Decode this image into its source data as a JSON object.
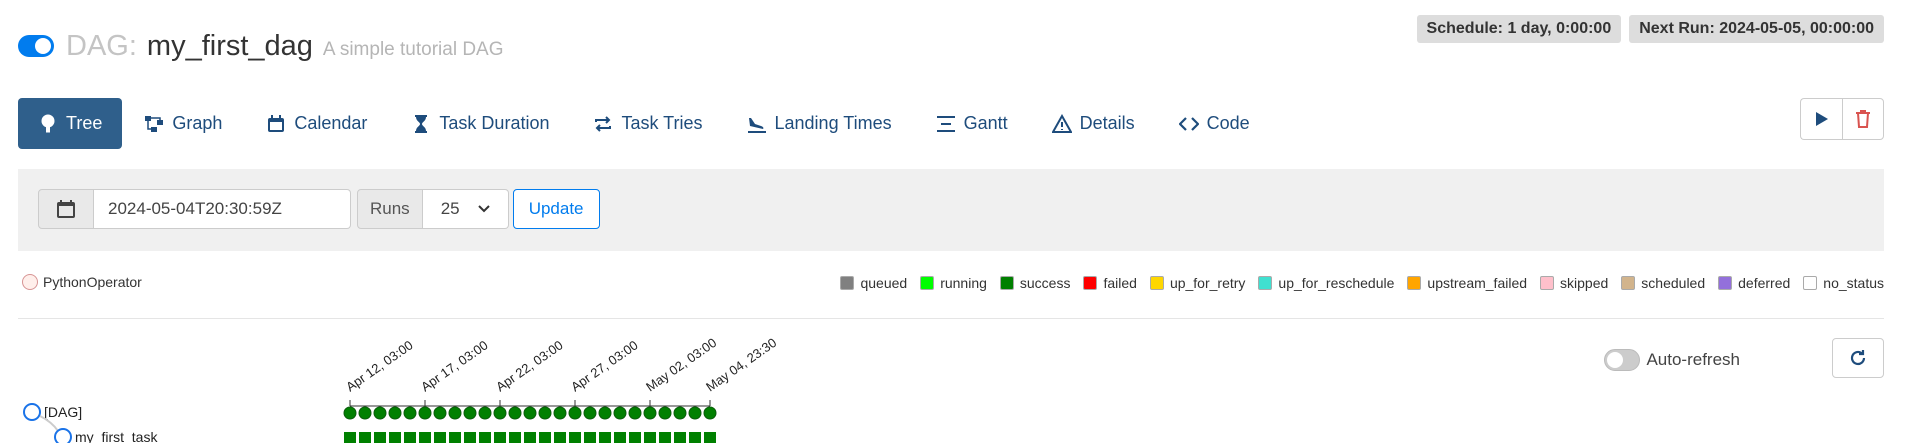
{
  "header": {
    "dag_prefix": "DAG:",
    "dag_name": "my_first_dag",
    "description": "A simple tutorial DAG",
    "paused": false,
    "schedule": "Schedule: 1 day, 0:00:00",
    "next_run": "Next Run: 2024-05-05, 00:00:00"
  },
  "nav": [
    {
      "label": "Tree",
      "icon": "tree-icon",
      "active": true
    },
    {
      "label": "Graph",
      "icon": "graph-icon"
    },
    {
      "label": "Calendar",
      "icon": "calendar-icon"
    },
    {
      "label": "Task Duration",
      "icon": "hourglass-icon"
    },
    {
      "label": "Task Tries",
      "icon": "retry-icon"
    },
    {
      "label": "Landing Times",
      "icon": "plane-landing-icon"
    },
    {
      "label": "Gantt",
      "icon": "gantt-icon"
    },
    {
      "label": "Details",
      "icon": "warning-triangle-icon"
    },
    {
      "label": "Code",
      "icon": "code-icon"
    }
  ],
  "actions": {
    "trigger_icon": "play-icon",
    "delete_icon": "trash-icon"
  },
  "form": {
    "date_value": "2024-05-04T20:30:59Z",
    "runs_label": "Runs",
    "runs_value": "25",
    "update_label": "Update"
  },
  "operators": [
    {
      "label": "PythonOperator",
      "color": "#ffefeb",
      "border": "#d79494"
    }
  ],
  "states": [
    {
      "label": "queued",
      "color": "#808080"
    },
    {
      "label": "running",
      "color": "#00ff00"
    },
    {
      "label": "success",
      "color": "#008000"
    },
    {
      "label": "failed",
      "color": "#ff0000"
    },
    {
      "label": "up_for_retry",
      "color": "#ffd700"
    },
    {
      "label": "up_for_reschedule",
      "color": "#40e0d0"
    },
    {
      "label": "upstream_failed",
      "color": "#ffa500"
    },
    {
      "label": "skipped",
      "color": "#ffc0cb"
    },
    {
      "label": "scheduled",
      "color": "#d2b48c"
    },
    {
      "label": "deferred",
      "color": "#9370db"
    },
    {
      "label": "no_status",
      "color": "#ffffff"
    }
  ],
  "tree": {
    "date_labels": [
      "Apr 12, 03:00",
      "Apr 17, 03:00",
      "Apr 22, 03:00",
      "Apr 27, 03:00",
      "May 02, 03:00",
      "May 04, 23:30"
    ],
    "nodes": [
      "[DAG]",
      "my_first_task"
    ],
    "run_count": 25,
    "run_state": "success",
    "task_state": "success"
  },
  "autorefresh": {
    "label": "Auto-refresh",
    "enabled": false
  }
}
